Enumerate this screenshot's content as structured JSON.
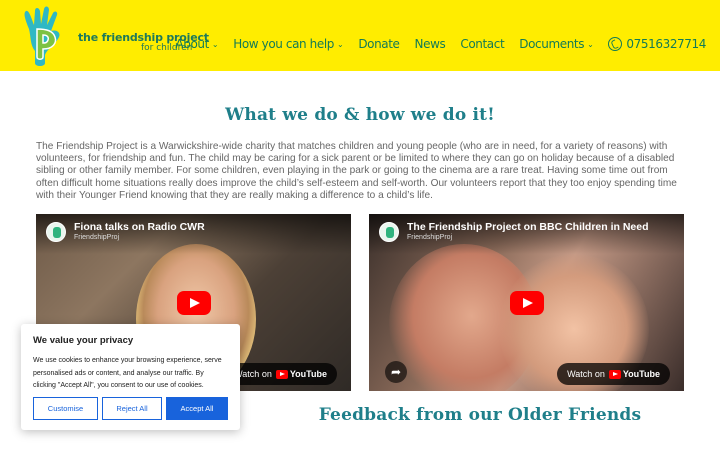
{
  "header": {
    "logo_line1": "the friendship project",
    "logo_line2": "for children",
    "nav": [
      {
        "label": "About",
        "dropdown": true
      },
      {
        "label": "How you can help",
        "dropdown": true
      },
      {
        "label": "Donate",
        "dropdown": false
      },
      {
        "label": "News",
        "dropdown": false
      },
      {
        "label": "Contact",
        "dropdown": false
      },
      {
        "label": "Documents",
        "dropdown": true
      }
    ],
    "phone": "07516327714",
    "colors": {
      "background": "#ffed00",
      "text": "#137b55"
    }
  },
  "main": {
    "title": "What we do & how we do it!",
    "intro": "The Friendship Project is a Warwickshire-wide charity that matches children and young people (who are in need, for a variety of reasons) with volunteers, for friendship and fun. The child may be caring for a sick parent or be limited to where they can go on holiday because of a disabled sibling or other family member. For some children, even playing in the park or going to the cinema are a rare treat. Having some time out from often difficult home situations really does improve the child’s self-esteem and self-worth. Our volunteers report that they too enjoy spending time with their Younger Friend knowing that they are really making a difference to a child’s life.",
    "videos": [
      {
        "title": "Fiona talks on Radio CWR",
        "channel": "FriendshipProj",
        "watch_prefix": "Watch on",
        "watch_brand": "YouTube"
      },
      {
        "title": "The Friendship Project on BBC Children in Need",
        "channel": "FriendshipProj",
        "watch_prefix": "Watch on",
        "watch_brand": "YouTube"
      }
    ],
    "feedback_title": "Feedback from our Older Friends"
  },
  "cookie": {
    "title": "We value your privacy",
    "text": "We use cookies to enhance your browsing experience, serve personalised ads or content, and analyse our traffic. By clicking \"Accept All\", you consent to our use of cookies.",
    "customise": "Customise",
    "reject": "Reject All",
    "accept": "Accept All"
  }
}
